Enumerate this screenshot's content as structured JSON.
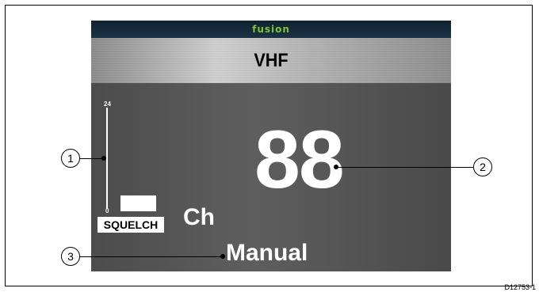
{
  "display": {
    "brand": "fusion",
    "title": "VHF",
    "channel_number": "88",
    "channel_label": "Ch",
    "mode": "Manual",
    "squelch": {
      "label": "SQUELCH",
      "scale_max": "24",
      "scale_min": "0"
    }
  },
  "callouts": [
    "1",
    "2",
    "3"
  ],
  "figure_ref": "D12753-1",
  "colors": {
    "brand_green": "#7ec42a",
    "brand_bar": "#0f2130",
    "screen_bg": "#555555",
    "text_primary": "#ffffff"
  }
}
